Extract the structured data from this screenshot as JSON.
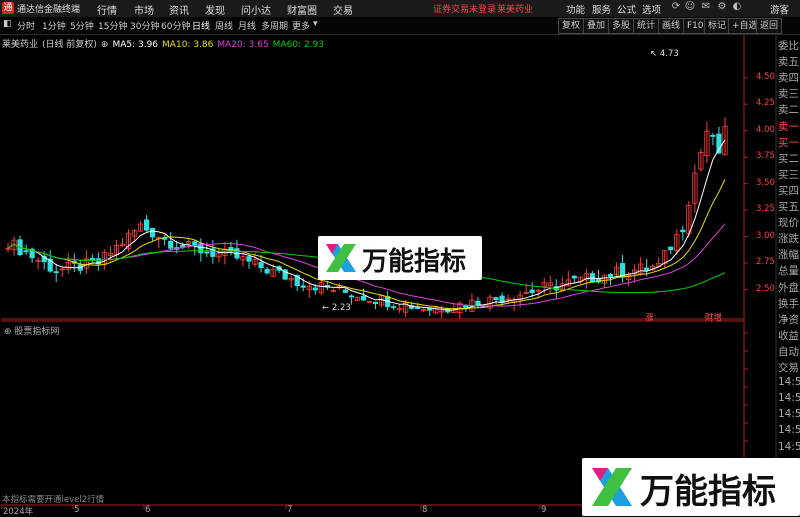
{
  "app": {
    "logo_text": "通",
    "title": "通达信金融终端"
  },
  "menu": [
    "行情",
    "市场",
    "资讯",
    "发现",
    "问小达",
    "财富圈",
    "交易"
  ],
  "notice": {
    "left": "证券交易未登录",
    "right": "莱美药业"
  },
  "right_menu": [
    "功能",
    "服务",
    "公式",
    "选项",
    "游客"
  ],
  "toolbar": {
    "periods": [
      "分时",
      "1分钟",
      "5分钟",
      "15分钟",
      "30分钟",
      "60分钟",
      "日线",
      "周线",
      "月线",
      "多周期",
      "更多"
    ],
    "active": "日线",
    "buttons": [
      "复权",
      "叠加",
      "多股",
      "统计",
      "画线",
      "F10",
      "标记",
      "+自选",
      "返回"
    ]
  },
  "stock": {
    "name": "莱美药业",
    "subtitle": "(日线 前复权)",
    "ma": [
      {
        "label": "MA5: 3.96",
        "color": "#ffffff"
      },
      {
        "label": "MA10: 3.86",
        "color": "#e8e000"
      },
      {
        "label": "MA20: 3.65",
        "color": "#e040e0"
      },
      {
        "label": "MA60: 2.93",
        "color": "#00d000"
      }
    ]
  },
  "colors": {
    "up": "#ff3c3c",
    "down": "#33dddd",
    "axis": "#aa2222",
    "price_label": "#ff4040"
  },
  "chart_data": {
    "type": "candlestick",
    "y_ticks": [
      "4.50",
      "4.25",
      "4.00",
      "3.75",
      "3.50",
      "3.25",
      "3.00",
      "2.75",
      "2.50"
    ],
    "x_ticks": [
      "2024年",
      "5",
      "6",
      "7",
      "8",
      "9"
    ],
    "annotations": {
      "high": "4.73",
      "low": "2.23",
      "tag_a": "涨",
      "tag_b": "财增"
    }
  },
  "indicator": {
    "label": "股票指标网"
  },
  "level2_text": "本指标需要开通level2行情",
  "side_list": [
    "委比",
    "卖五",
    "卖四",
    "卖三",
    "卖二",
    "卖一",
    "买一",
    "买二",
    "买三",
    "买四",
    "买五",
    "现价",
    "涨跌",
    "涨幅",
    "总量",
    "外盘",
    "换手",
    "净资",
    "收益",
    "自动",
    "交易",
    "14:5",
    "14:5",
    "14:5",
    "14:5",
    "14:5",
    "14:5",
    "14:5",
    "14:5"
  ],
  "watermark": {
    "text": "万能指标"
  }
}
